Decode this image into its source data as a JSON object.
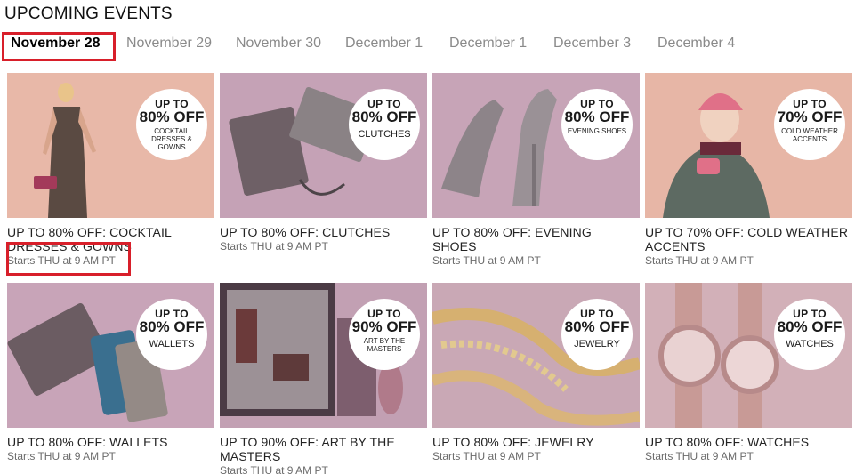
{
  "page": {
    "title": "UPCOMING EVENTS"
  },
  "tabs": [
    {
      "label": "November 28",
      "active": true
    },
    {
      "label": "November 29",
      "active": false
    },
    {
      "label": "November 30",
      "active": false
    },
    {
      "label": "December 1",
      "active": false
    },
    {
      "label": "December 1",
      "active": false
    },
    {
      "label": "December 3",
      "active": false
    },
    {
      "label": "December 4",
      "active": false
    }
  ],
  "colors": {
    "accent_red": "#d81f2a",
    "tile_pink": "#e9b7a6",
    "tile_mauve": "#c7a3b6"
  },
  "events": [
    {
      "title": "UP TO 80% OFF: COCKTAIL DRESSES & GOWNS",
      "start": "Starts THU at 9 AM PT",
      "badge": {
        "up": "UP TO",
        "pct": "80% OFF",
        "sub": "COCKTAIL DRESSES & GOWNS"
      },
      "icon": "dress-model-image"
    },
    {
      "title": "UP TO 80% OFF: CLUTCHES",
      "start": "Starts THU at 9 AM PT",
      "badge": {
        "up": "UP TO",
        "pct": "80% OFF",
        "sub": "CLUTCHES"
      },
      "icon": "clutch-image"
    },
    {
      "title": "UP TO 80% OFF: EVENING SHOES",
      "start": "Starts THU at 9 AM PT",
      "badge": {
        "up": "UP TO",
        "pct": "80% OFF",
        "sub": "EVENING SHOES"
      },
      "icon": "heel-shoe-image"
    },
    {
      "title": "UP TO 70% OFF: COLD WEATHER ACCENTS",
      "start": "Starts THU at 9 AM PT",
      "badge": {
        "up": "UP TO",
        "pct": "70% OFF",
        "sub": "COLD WEATHER ACCENTS"
      },
      "icon": "winter-model-image"
    },
    {
      "title": "UP TO 80% OFF: WALLETS",
      "start": "Starts THU at 9 AM PT",
      "badge": {
        "up": "UP TO",
        "pct": "80% OFF",
        "sub": "WALLETS"
      },
      "icon": "wallet-image"
    },
    {
      "title": "UP TO 90% OFF: ART BY THE MASTERS",
      "start": "Starts THU at 9 AM PT",
      "badge": {
        "up": "UP TO",
        "pct": "90% OFF",
        "sub": "ART BY THE MASTERS"
      },
      "icon": "framed-art-image"
    },
    {
      "title": "UP TO 80% OFF: JEWELRY",
      "start": "Starts THU at 9 AM PT",
      "badge": {
        "up": "UP TO",
        "pct": "80% OFF",
        "sub": "JEWELRY"
      },
      "icon": "necklace-image"
    },
    {
      "title": "UP TO 80% OFF: WATCHES",
      "start": "Starts THU at 9 AM PT",
      "badge": {
        "up": "UP TO",
        "pct": "80% OFF",
        "sub": "WATCHES"
      },
      "icon": "watches-image"
    }
  ]
}
